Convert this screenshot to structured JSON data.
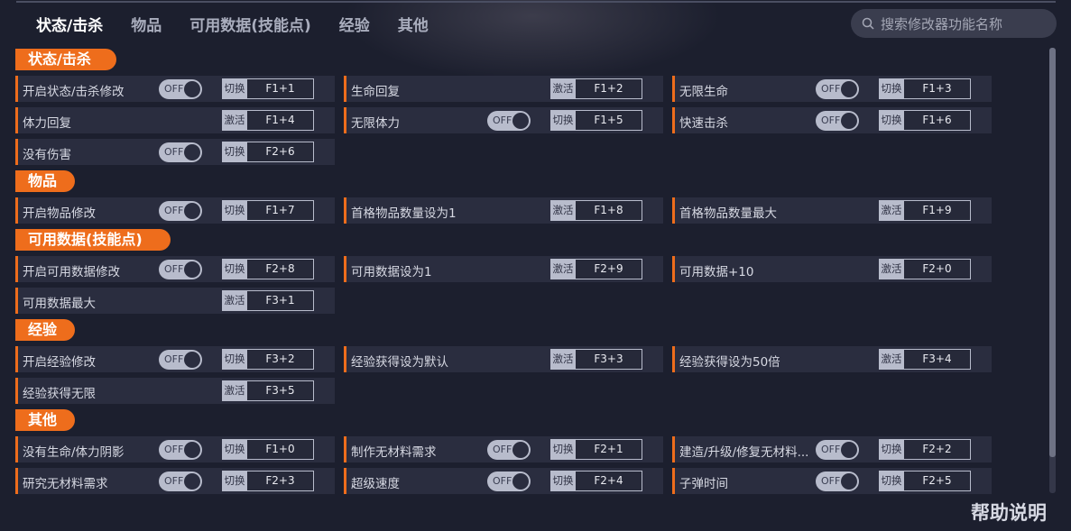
{
  "tabs": [
    "状态/击杀",
    "物品",
    "可用数据(技能点)",
    "经验",
    "其他"
  ],
  "search": {
    "placeholder": "搜索修改器功能名称"
  },
  "help_label": "帮助说明",
  "colors": {
    "accent": "#ee6d1c",
    "background": "#1c1f2e",
    "row": "#2a2d3f"
  },
  "sections": [
    {
      "title": "状态/击杀",
      "items": [
        {
          "label": "开启状态/击杀修改",
          "toggle": "OFF",
          "mode": "切换",
          "key": "F1+1"
        },
        {
          "label": "生命回复",
          "toggle": "",
          "mode": "激活",
          "key": "F1+2"
        },
        {
          "label": "无限生命",
          "toggle": "OFF",
          "mode": "切换",
          "key": "F1+3"
        },
        {
          "label": "体力回复",
          "toggle": "",
          "mode": "激活",
          "key": "F1+4"
        },
        {
          "label": "无限体力",
          "toggle": "OFF",
          "mode": "切换",
          "key": "F1+5"
        },
        {
          "label": "快速击杀",
          "toggle": "OFF",
          "mode": "切换",
          "key": "F1+6"
        },
        {
          "label": "没有伤害",
          "toggle": "OFF",
          "mode": "切换",
          "key": "F2+6"
        }
      ]
    },
    {
      "title": "物品",
      "items": [
        {
          "label": "开启物品修改",
          "toggle": "OFF",
          "mode": "切换",
          "key": "F1+7"
        },
        {
          "label": "首格物品数量设为1",
          "toggle": "",
          "mode": "激活",
          "key": "F1+8"
        },
        {
          "label": "首格物品数量最大",
          "toggle": "",
          "mode": "激活",
          "key": "F1+9"
        }
      ]
    },
    {
      "title": "可用数据(技能点)",
      "items": [
        {
          "label": "开启可用数据修改",
          "toggle": "OFF",
          "mode": "切换",
          "key": "F2+8"
        },
        {
          "label": "可用数据设为1",
          "toggle": "",
          "mode": "激活",
          "key": "F2+9"
        },
        {
          "label": "可用数据+10",
          "toggle": "",
          "mode": "激活",
          "key": "F2+0"
        },
        {
          "label": "可用数据最大",
          "toggle": "",
          "mode": "激活",
          "key": "F3+1"
        }
      ]
    },
    {
      "title": "经验",
      "items": [
        {
          "label": "开启经验修改",
          "toggle": "OFF",
          "mode": "切换",
          "key": "F3+2"
        },
        {
          "label": "经验获得设为默认",
          "toggle": "",
          "mode": "激活",
          "key": "F3+3"
        },
        {
          "label": "经验获得设为50倍",
          "toggle": "",
          "mode": "激活",
          "key": "F3+4"
        },
        {
          "label": "经验获得无限",
          "toggle": "",
          "mode": "激活",
          "key": "F3+5"
        }
      ]
    },
    {
      "title": "其他",
      "items": [
        {
          "label": "没有生命/体力阴影",
          "toggle": "OFF",
          "mode": "切换",
          "key": "F1+0"
        },
        {
          "label": "制作无材料需求",
          "toggle": "OFF",
          "mode": "切换",
          "key": "F2+1"
        },
        {
          "label": "建造/升级/修复无材料...",
          "toggle": "OFF",
          "mode": "切换",
          "key": "F2+2"
        },
        {
          "label": "研究无材料需求",
          "toggle": "OFF",
          "mode": "切换",
          "key": "F2+3"
        },
        {
          "label": "超级速度",
          "toggle": "OFF",
          "mode": "切换",
          "key": "F2+4"
        },
        {
          "label": "子弹时间",
          "toggle": "OFF",
          "mode": "切换",
          "key": "F2+5"
        }
      ]
    }
  ]
}
